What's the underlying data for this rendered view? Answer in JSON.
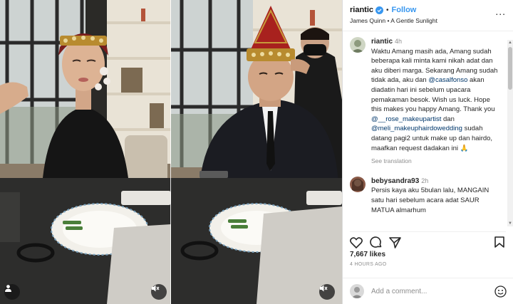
{
  "header": {
    "username": "riantic",
    "follow_label": "Follow",
    "separator": "•",
    "audio": "James Quinn • A Gentle Sunlight",
    "more": "..."
  },
  "caption": {
    "username": "riantic",
    "time": "4h",
    "text_part1": "Waktu Amang masih ada, Amang sudah beberapa kali minta kami nikah adat dan aku diberi marga. Sekarang Amang sudah tidak ada, aku dan ",
    "mention1": "@casalfonso",
    "text_part2": " akan diadatin hari ini sebelum upacara pemakaman besok. Wish us luck. Hope this makes you happy Amang. Thank you ",
    "mention2": "@__rose_makeupartist",
    "text_part3": " dan ",
    "mention3": "@meli_makeuphairdowedding",
    "text_part4": " sudah datang pagi2 untuk make up dan hairdo, maafkan request dadakan ini 🙏",
    "see_translation": "See translation"
  },
  "comment2": {
    "username": "bebysandra93",
    "time": "2h",
    "text": "Persis kaya aku 5bulan lalu, MANGAIN satu hari sebelum acara adat SAUR MATUA almarhum"
  },
  "likes": "7,667 likes",
  "time_ago": "4 HOURS AGO",
  "add_comment": {
    "placeholder": "Add a comment..."
  },
  "icons": {
    "like": "heart-icon",
    "comment": "comment-icon",
    "share": "share-icon",
    "save": "bookmark-icon",
    "emoji": "smiley-icon",
    "mute": "speaker-muted-icon",
    "user": "user-icon",
    "verified": "verified-badge-icon"
  },
  "colors": {
    "accent": "#3897f0",
    "mention": "#00376b",
    "muted_text": "#8e8e8e",
    "divider": "#efefef"
  }
}
